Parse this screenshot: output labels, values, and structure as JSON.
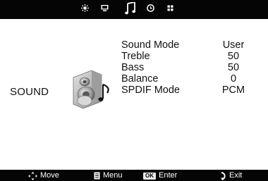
{
  "top_menu": {
    "icons": [
      "picture-icon",
      "screen-icon",
      "sound-icon",
      "time-icon",
      "setup-icon"
    ],
    "active": "sound-icon"
  },
  "section": {
    "title": "SOUND"
  },
  "sound_menu": {
    "items": [
      {
        "label": "Sound Mode",
        "value": "User"
      },
      {
        "label": "Treble",
        "value": "50"
      },
      {
        "label": "Bass",
        "value": "50"
      },
      {
        "label": "Balance",
        "value": "0"
      },
      {
        "label": "SPDIF Mode",
        "value": "PCM"
      }
    ]
  },
  "bottom_bar": {
    "move": "Move",
    "menu": "Menu",
    "ok_key": "OK",
    "enter": "Enter",
    "exit": "Exit"
  },
  "colors": {
    "bar": "#050505",
    "background": "#ffffff",
    "text": "#111111"
  }
}
